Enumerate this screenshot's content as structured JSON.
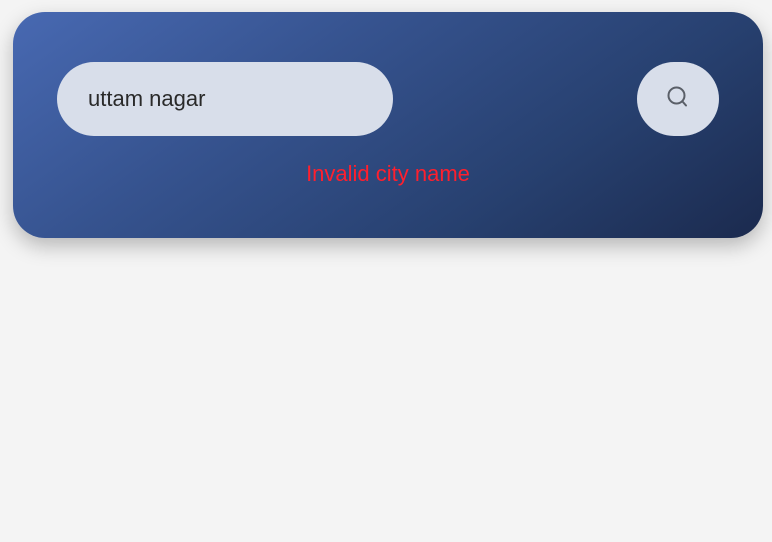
{
  "search": {
    "value": "uttam nagar",
    "placeholder": ""
  },
  "search_button": {
    "icon": "search-icon"
  },
  "error": {
    "message": "Invalid city name"
  },
  "colors": {
    "page_background": "#f4f4f4",
    "card_gradient_start": "#4869b2",
    "card_gradient_end": "#1b2a4e",
    "field_background": "#d8deea",
    "error_text": "#ff1f2d"
  }
}
